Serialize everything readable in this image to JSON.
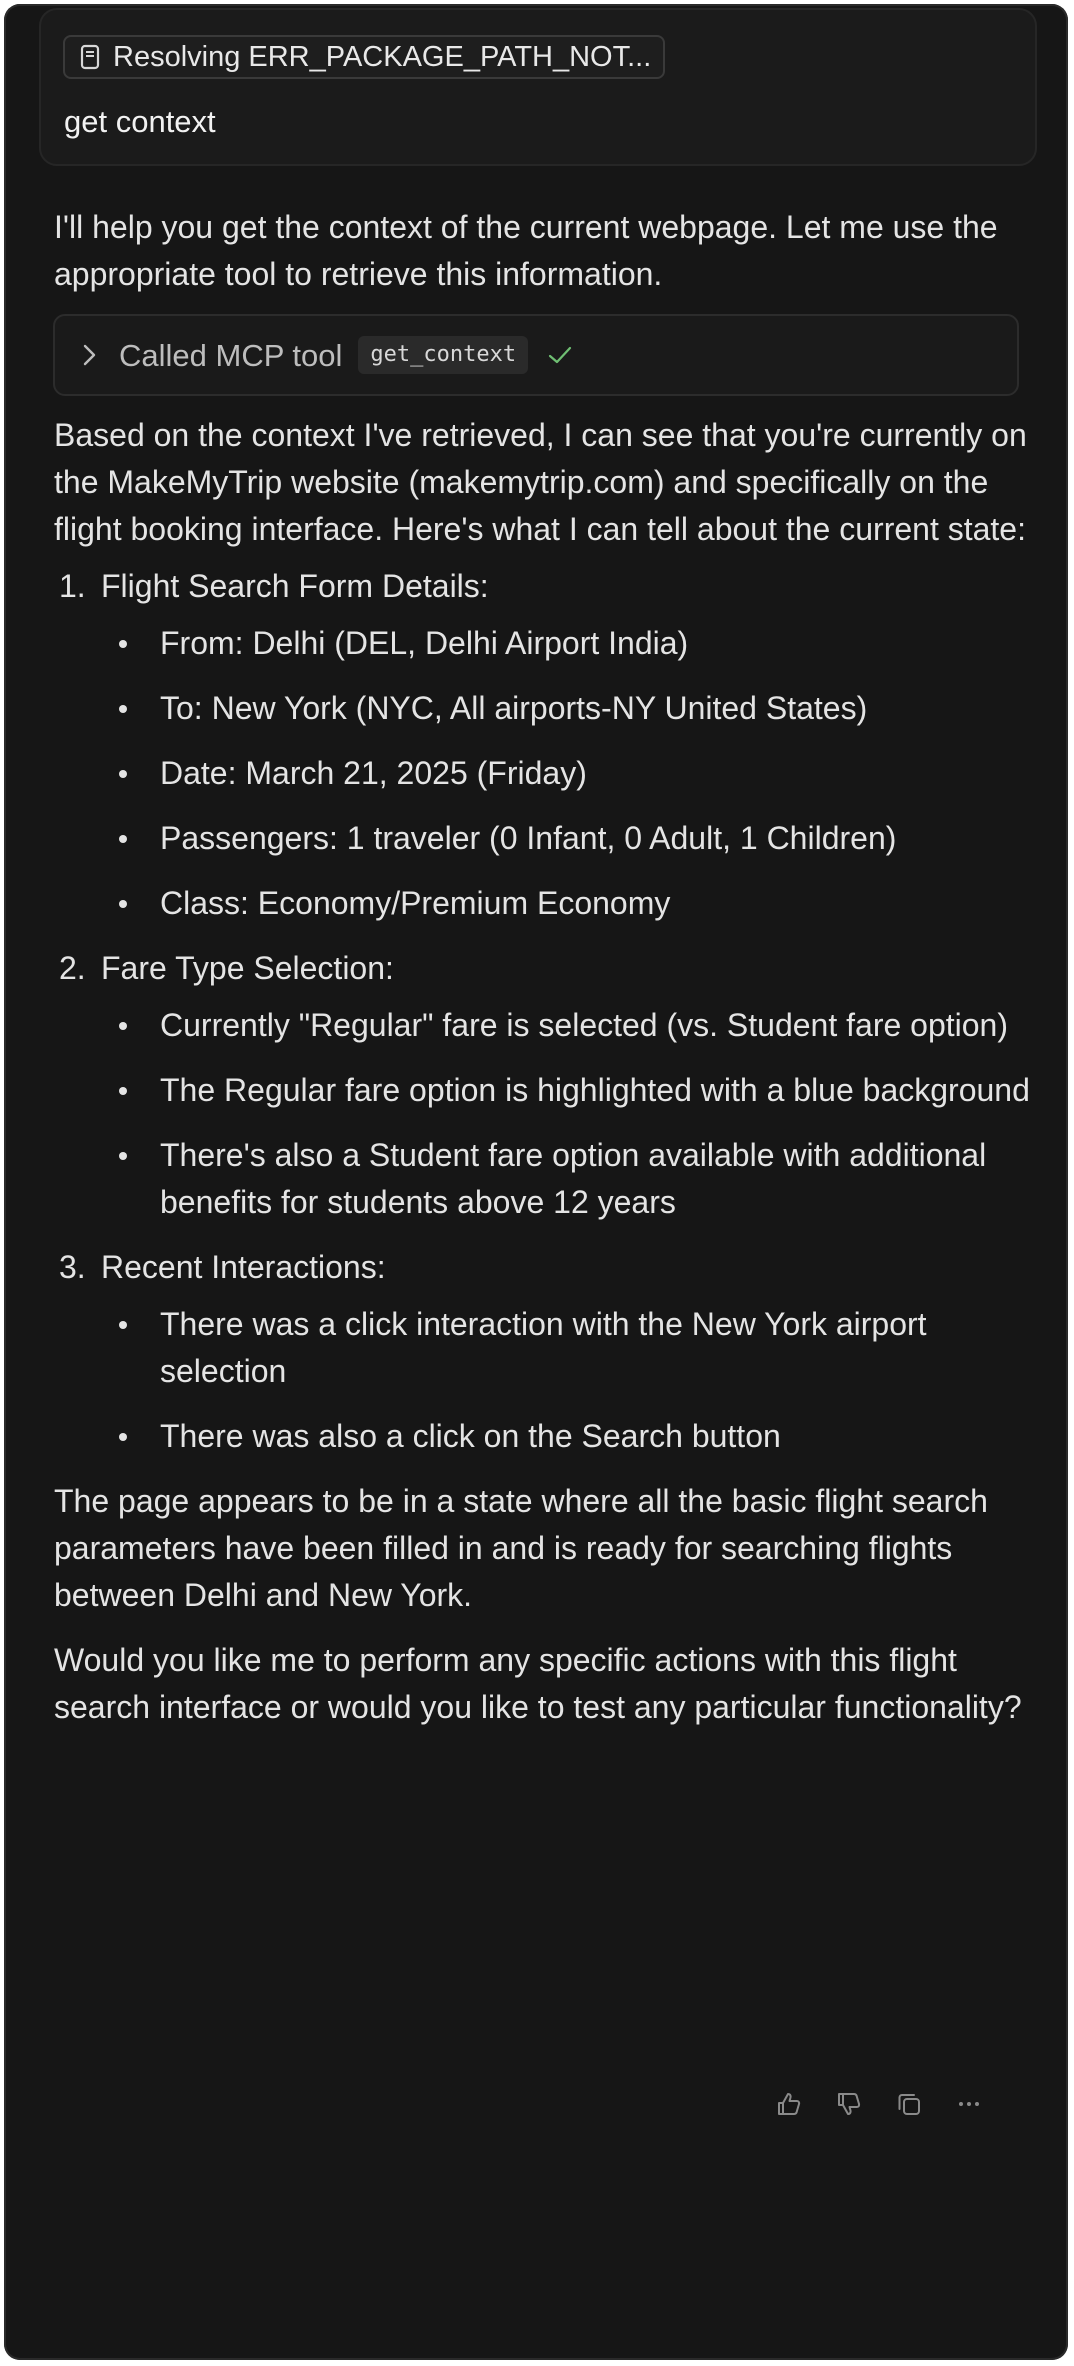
{
  "user_message": {
    "context_chip": "Resolving ERR_PACKAGE_PATH_NOT...",
    "text": "get context"
  },
  "assistant": {
    "intro": "I'll help you get the context of the current webpage. Let me use the appropriate tool to retrieve this information.",
    "tool_call": {
      "label": "Called MCP tool",
      "tool_name": "get_context",
      "status_icon": "check-icon"
    },
    "summary": "Based on the context I've retrieved, I can see that you're currently on the MakeMyTrip website (makemytrip.com) and specifically on the flight booking interface. Here's what I can tell about the current state:",
    "sections": [
      {
        "number": "1.",
        "title": "Flight Search Form Details:",
        "items": [
          "From: Delhi (DEL, Delhi Airport India)",
          "To: New York (NYC, All airports-NY United States)",
          "Date: March 21, 2025 (Friday)",
          "Passengers: 1 traveler (0 Infant, 0 Adult, 1 Children)",
          "Class: Economy/Premium Economy"
        ]
      },
      {
        "number": "2.",
        "title": "Fare Type Selection:",
        "items": [
          "Currently \"Regular\" fare is selected (vs. Student fare option)",
          "The Regular fare option is highlighted with a blue background",
          "There's also a Student fare option available with additional benefits for students above 12 years"
        ]
      },
      {
        "number": "3.",
        "title": "Recent Interactions:",
        "items": [
          "There was a click interaction with the New York airport selection",
          "There was also a click on the Search button"
        ]
      }
    ],
    "closing": "The page appears to be in a state where all the basic flight search parameters have been filled in and is ready for searching flights between Delhi and New York.",
    "question": "Would you like me to perform any specific actions with this flight search interface or would you like to test any particular functionality?"
  },
  "message_actions": [
    "thumbs-up-icon",
    "thumbs-down-icon",
    "copy-icon",
    "more-icon"
  ],
  "colors": {
    "background": "#161616",
    "text": "#e4e4e4",
    "check": "#6fbf73"
  }
}
